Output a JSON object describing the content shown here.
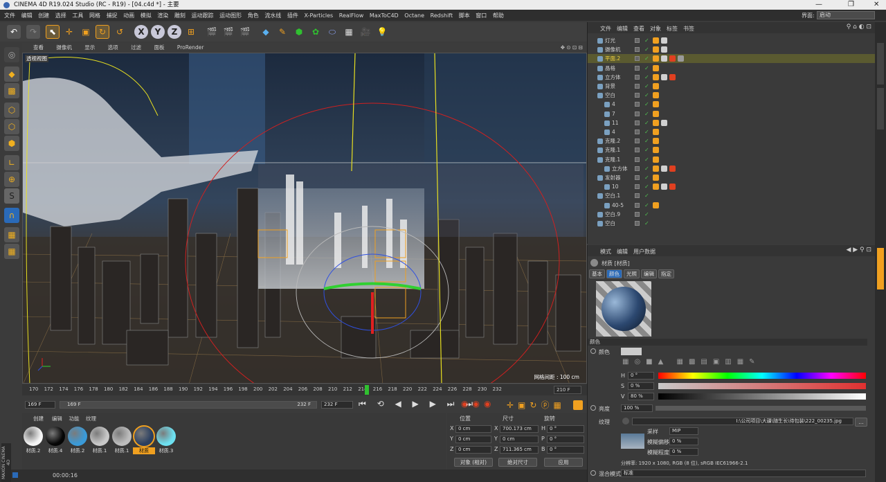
{
  "window": {
    "title": "CINEMA 4D R19.024 Studio (RC - R19) - [04.c4d *] - 主要"
  },
  "menu": [
    "文件",
    "编辑",
    "创建",
    "选择",
    "工具",
    "网格",
    "捕捉",
    "动画",
    "模拟",
    "渲染",
    "雕刻",
    "运动跟踪",
    "运动图形",
    "角色",
    "流水线",
    "插件",
    "X-Particles",
    "RealFlow",
    "MaxToC4D",
    "Octane",
    "Redshift",
    "脚本",
    "窗口",
    "帮助"
  ],
  "layout_label": "界面:",
  "layout_value": "启动",
  "viewport": {
    "menu": [
      "查看",
      "摄像机",
      "显示",
      "选项",
      "过滤",
      "面板",
      "ProRender"
    ],
    "name": "透视视图",
    "grid_info": "网格间距 : 100 cm"
  },
  "timeline": {
    "ticks": [
      "170",
      "172",
      "174",
      "176",
      "178",
      "180",
      "182",
      "184",
      "186",
      "188",
      "190",
      "192",
      "194",
      "196",
      "198",
      "200",
      "202",
      "204",
      "206",
      "208",
      "210",
      "212",
      "214",
      "216",
      "218",
      "220",
      "222",
      "224",
      "226",
      "228",
      "230",
      "232"
    ],
    "current_frame": "210 F",
    "start_field": "169 F",
    "range_start": "169 F",
    "range_end": "232 F",
    "end_field": "232 F"
  },
  "materials": {
    "menu": [
      "创建",
      "编辑",
      "功能",
      "纹理"
    ],
    "items": [
      {
        "label": "材质.2",
        "color": "#f5f5f5"
      },
      {
        "label": "材质.4",
        "color": "#050505"
      },
      {
        "label": "材质.2",
        "color": "#3a9ad8"
      },
      {
        "label": "材质.1",
        "color": "#c8c8c8"
      },
      {
        "label": "材质.1",
        "color": "#bdbdbd"
      },
      {
        "label": "材质",
        "color": "#2a3f60"
      },
      {
        "label": "材质.3",
        "color": "#6de0f0"
      }
    ]
  },
  "coords": {
    "headers": [
      "位置",
      "尺寸",
      "旋转"
    ],
    "rows": [
      {
        "axis": "X",
        "pos": "0 cm",
        "size_axis": "X",
        "size": "700.173 cm",
        "rot_axis": "H",
        "rot": "0 °"
      },
      {
        "axis": "Y",
        "pos": "0 cm",
        "size_axis": "Y",
        "size": "0 cm",
        "rot_axis": "P",
        "rot": "0 °"
      },
      {
        "axis": "Z",
        "pos": "0 cm",
        "size_axis": "Z",
        "size": "711.365 cm",
        "rot_axis": "B",
        "rot": "0 °"
      }
    ],
    "mode1": "对象 (相对)",
    "mode2": "绝对尺寸",
    "apply": "应用"
  },
  "status": {
    "time": "00:00:16",
    "brand_top": "MAXON",
    "brand_bottom": "CINEMA 4D"
  },
  "object_manager": {
    "menu": [
      "文件",
      "编辑",
      "查看",
      "对象",
      "标签",
      "书签"
    ],
    "objects": [
      {
        "name": "灯光",
        "indent": 0,
        "tags": 2
      },
      {
        "name": "摄像机",
        "indent": 0,
        "tags": 2
      },
      {
        "name": "平面.2",
        "indent": 0,
        "tags": 4,
        "highlight": true
      },
      {
        "name": "晶格",
        "indent": 0,
        "tags": 1
      },
      {
        "name": "立方体",
        "indent": 0,
        "tags": 3
      },
      {
        "name": "背景",
        "indent": 0,
        "tags": 1
      },
      {
        "name": "空白",
        "indent": 0,
        "tags": 1
      },
      {
        "name": "4",
        "indent": 1,
        "tags": 1
      },
      {
        "name": "7",
        "indent": 1,
        "tags": 1
      },
      {
        "name": "11",
        "indent": 1,
        "tags": 2
      },
      {
        "name": "4",
        "indent": 1,
        "tags": 1
      },
      {
        "name": "克隆.2",
        "indent": 0,
        "tags": 1
      },
      {
        "name": "克隆.1",
        "indent": 0,
        "tags": 1
      },
      {
        "name": "克隆.1",
        "indent": 0,
        "tags": 1
      },
      {
        "name": "立方体",
        "indent": 1,
        "tags": 3
      },
      {
        "name": "发射器",
        "indent": 0,
        "tags": 1
      },
      {
        "name": "10",
        "indent": 1,
        "tags": 3
      },
      {
        "name": "空白.1",
        "indent": 0,
        "tags": 0
      },
      {
        "name": "40-5",
        "indent": 1,
        "tags": 1
      },
      {
        "name": "空白.9",
        "indent": 0,
        "tags": 0
      },
      {
        "name": "空白",
        "indent": 0,
        "tags": 0
      }
    ]
  },
  "attributes": {
    "menu": [
      "模式",
      "编辑",
      "用户数据"
    ],
    "title": "材质 [材质]",
    "tabs": [
      "基本",
      "颜色",
      "光照",
      "编辑",
      "指定"
    ],
    "section": "颜色",
    "color_label": "颜色",
    "hsv": [
      {
        "label": "H",
        "value": "0 °"
      },
      {
        "label": "S",
        "value": "0 %"
      },
      {
        "label": "V",
        "value": "80 %"
      }
    ],
    "brightness_label": "亮度",
    "brightness_value": "100 %",
    "texture_label": "纹理",
    "texture_path": "I:\\公司项目\\大疆\\随生长\\待包装\\222_00235.jpg",
    "sampling_label": "采样",
    "sampling_value": "MIP",
    "blur_offset_label": "模糊偏移",
    "blur_offset_value": "0 %",
    "blur_scale_label": "模糊程度",
    "blur_scale_value": "0 %",
    "resolution": "分辨率: 1920 x 1080, RGB (8 位), sRGB IEC61966-2.1",
    "blend_label": "混合模式",
    "blend_value": "标准"
  },
  "colors": {
    "accent": "#f0a020",
    "red_axis": "#e02020",
    "green_axis": "#30d030",
    "blue_axis": "#3050e0",
    "highlight_row": "#5a5a30"
  }
}
